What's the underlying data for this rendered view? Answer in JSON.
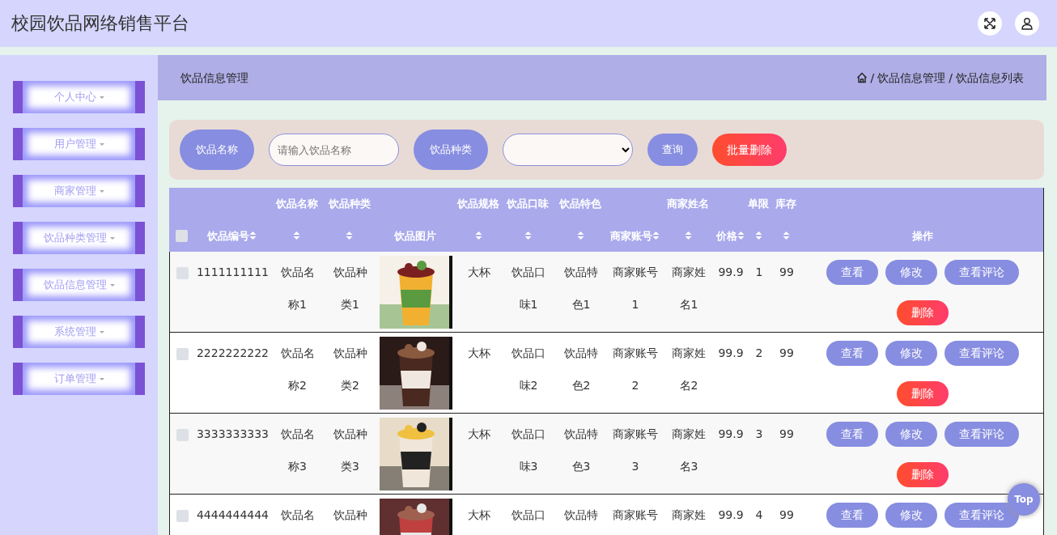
{
  "header": {
    "title": "校园饮品网络销售平台"
  },
  "sidebar": {
    "items": [
      {
        "label": "个人中心"
      },
      {
        "label": "用户管理"
      },
      {
        "label": "商家管理"
      },
      {
        "label": "饮品种类管理"
      },
      {
        "label": "饮品信息管理"
      },
      {
        "label": "系统管理"
      },
      {
        "label": "订单管理"
      }
    ]
  },
  "page_header": {
    "title": "饮品信息管理",
    "breadcrumb": [
      "饮品信息管理",
      "饮品信息列表"
    ],
    "separator": "/"
  },
  "search": {
    "name_label": "饮品名称",
    "name_placeholder": "请输入饮品名称",
    "type_label": "饮品种类",
    "query_button": "查询",
    "batch_delete_button": "批量删除"
  },
  "table": {
    "select_all": {
      "checked": false
    },
    "columns": [
      {
        "label": "饮品编号",
        "kind": "inline",
        "sortable": true
      },
      {
        "label": "饮品名称",
        "kind": "stacked",
        "sortable": true
      },
      {
        "label": "饮品种类",
        "kind": "stacked",
        "sortable": true
      },
      {
        "label": "饮品图片",
        "kind": "inline",
        "sortable": false
      },
      {
        "label": "饮品规格",
        "kind": "stacked",
        "sortable": true
      },
      {
        "label": "饮品口味",
        "kind": "stacked",
        "sortable": true
      },
      {
        "label": "饮品特色",
        "kind": "stacked",
        "sortable": true
      },
      {
        "label": "商家账号",
        "kind": "inline",
        "sortable": true
      },
      {
        "label": "商家姓名",
        "kind": "stacked",
        "sortable": true
      },
      {
        "label": "价格",
        "kind": "inline",
        "sortable": true
      },
      {
        "label": "单限",
        "kind": "stacked",
        "sortable": true
      },
      {
        "label": "库存",
        "kind": "stacked",
        "sortable": true
      },
      {
        "label": "操作",
        "kind": "inline",
        "sortable": false
      }
    ],
    "rows": [
      {
        "checked": false,
        "cells": [
          "1111111111",
          "饮品名称1",
          "饮品种类1",
          {
            "kind": "picture"
          },
          "大杯",
          "饮品口味1",
          "饮品特色1",
          "商家账号1",
          "商家姓名1",
          "99.9",
          "1",
          "99"
        ],
        "actions": [
          {
            "label": "查看",
            "kind": "primary"
          },
          {
            "label": "修改",
            "kind": "primary"
          },
          {
            "label": "查看评论",
            "kind": "primary"
          },
          {
            "label": "删除",
            "kind": "danger"
          }
        ]
      },
      {
        "checked": false,
        "cells": [
          "2222222222",
          "饮品名称2",
          "饮品种类2",
          {
            "kind": "picture"
          },
          "大杯",
          "饮品口味2",
          "饮品特色2",
          "商家账号2",
          "商家姓名2",
          "99.9",
          "2",
          "99"
        ],
        "actions": [
          {
            "label": "查看",
            "kind": "primary"
          },
          {
            "label": "修改",
            "kind": "primary"
          },
          {
            "label": "查看评论",
            "kind": "primary"
          },
          {
            "label": "删除",
            "kind": "danger"
          }
        ]
      },
      {
        "checked": false,
        "cells": [
          "3333333333",
          "饮品名称3",
          "饮品种类3",
          {
            "kind": "picture"
          },
          "大杯",
          "饮品口味3",
          "饮品特色3",
          "商家账号3",
          "商家姓名3",
          "99.9",
          "3",
          "99"
        ],
        "actions": [
          {
            "label": "查看",
            "kind": "primary"
          },
          {
            "label": "修改",
            "kind": "primary"
          },
          {
            "label": "查看评论",
            "kind": "primary"
          },
          {
            "label": "删除",
            "kind": "danger"
          }
        ]
      },
      {
        "checked": false,
        "cells": [
          "4444444444",
          "饮品名",
          "饮品种",
          {
            "kind": "picture"
          },
          "大杯",
          "饮品口",
          "饮品特",
          "商家账号",
          "商家姓",
          "99.9",
          "4",
          "99"
        ],
        "actions": [
          {
            "label": "查看",
            "kind": "primary"
          },
          {
            "label": "修改",
            "kind": "primary"
          },
          {
            "label": "查看评论",
            "kind": "primary"
          }
        ]
      }
    ]
  },
  "back_to_top": "Top"
}
